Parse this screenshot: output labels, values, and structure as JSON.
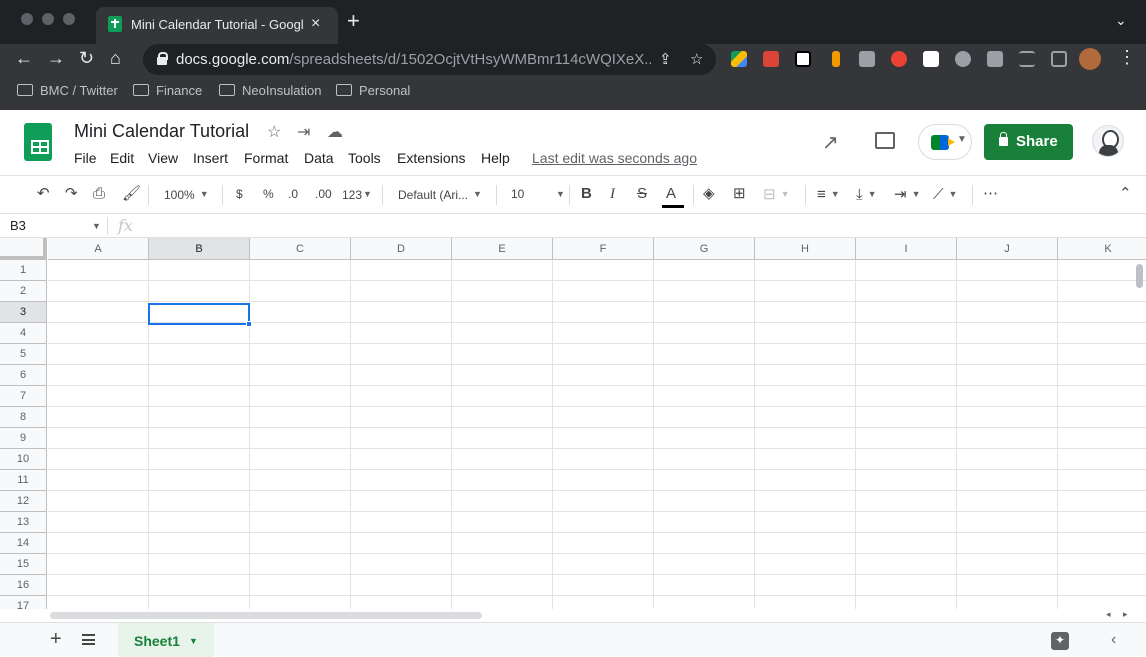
{
  "browser": {
    "tab_title": "Mini Calendar Tutorial - Google Sheets",
    "url_host": "docs.google.com",
    "url_path": "/spreadsheets/d/1502OcjtVtHsyWMBmr114cWQIXeX...",
    "bookmarks": [
      "BMC / Twitter",
      "Finance",
      "NeoInsulation",
      "Personal"
    ]
  },
  "sheets": {
    "doc_title": "Mini Calendar Tutorial",
    "menu": [
      "File",
      "Edit",
      "View",
      "Insert",
      "Format",
      "Data",
      "Tools",
      "Extensions",
      "Help"
    ],
    "last_edit": "Last edit was seconds ago",
    "share_label": "Share"
  },
  "toolbar": {
    "zoom": "100%",
    "currency": "$",
    "percent": "%",
    "decrease_decimal": ".0",
    "increase_decimal": ".00",
    "more_formats": "123",
    "font_family": "Default (Ari...",
    "font_size": "10",
    "bold": "B",
    "italic": "I",
    "strikethrough": "S",
    "text_color": "A"
  },
  "formula_bar": {
    "name_box": "B3",
    "fx": "fx"
  },
  "grid": {
    "columns": [
      "A",
      "B",
      "C",
      "D",
      "E",
      "F",
      "G",
      "H",
      "I",
      "J",
      "K"
    ],
    "rows": [
      "1",
      "2",
      "3",
      "4",
      "5",
      "6",
      "7",
      "8",
      "9",
      "10",
      "11",
      "12",
      "13",
      "14",
      "15",
      "16",
      "17"
    ],
    "active_cell": "B3"
  },
  "sheet_tabs": [
    "Sheet1"
  ],
  "colors": {
    "brand_green": "#188038",
    "selection_blue": "#1a73e8",
    "chrome_dark": "#35363a"
  }
}
